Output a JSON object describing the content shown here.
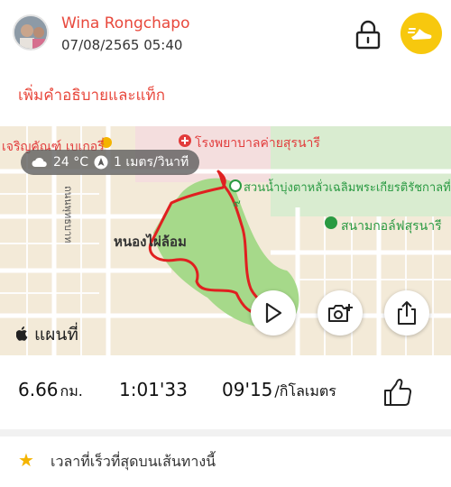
{
  "header": {
    "user_name": "Wina Rongchapo",
    "date": "07/08/2565 05:40"
  },
  "description_prompt": "เพิ่มคำอธิบายและแท็ก",
  "map": {
    "weather": {
      "temp": "24 °C",
      "wind": "1 เมตร/วินาที"
    },
    "pois": {
      "bakery": "เจริญคัณฑ์ เบเกอรี่",
      "hospital": "โรงพยาบาลค่ายสุรนารี",
      "park": "สวนน้ำบุ่งตาหลั่วเฉลิมพระเกียรติรัชกาลที่",
      "park_cont": "๙",
      "golf": "สนามกอล์ฟสุรนารี",
      "area": "หนองไผ่ล้อม",
      "road": "ถนนพุทธบาท"
    },
    "apple_maps_label": "แผนที่"
  },
  "stats": {
    "distance": "6.66",
    "distance_unit": "กม.",
    "duration": "1:01'33",
    "pace": "09'15",
    "pace_unit": "/กิโลเมตร"
  },
  "footer": {
    "best_time": "เวลาที่เร็วที่สุดบนเส้นทางนี้"
  },
  "colors": {
    "accent": "#e8483c",
    "badge": "#f7c80e",
    "route": "#e02020",
    "park_green": "#a6d98a"
  }
}
